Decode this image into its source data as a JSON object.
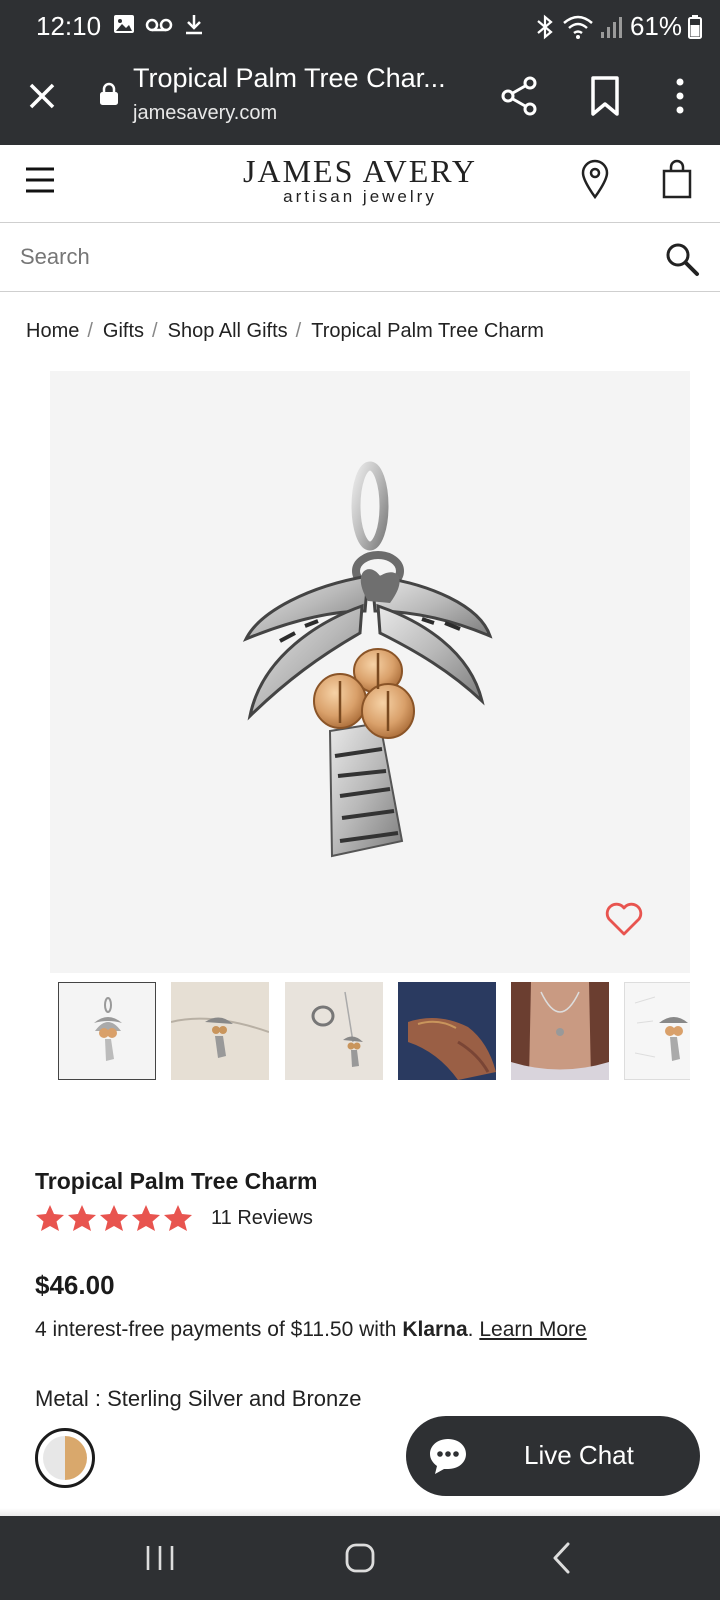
{
  "status_bar": {
    "time": "12:10",
    "battery": "61%",
    "icons": [
      "image-icon",
      "voicemail-icon",
      "download-icon",
      "bluetooth-icon",
      "wifi-icon",
      "signal-icon",
      "battery-icon"
    ]
  },
  "browser": {
    "title": "Tropical Palm Tree Char...",
    "domain": "jamesavery.com",
    "icons": [
      "close-icon",
      "lock-icon",
      "share-icon",
      "bookmark-icon",
      "more-vertical-icon"
    ]
  },
  "site_header": {
    "brand_name": "JAMES AVERY",
    "brand_tagline": "artisan jewelry",
    "icons": [
      "menu-icon",
      "location-pin-icon",
      "shopping-bag-icon"
    ]
  },
  "search": {
    "placeholder": "Search"
  },
  "breadcrumb": {
    "items": [
      "Home",
      "Gifts",
      "Shop All Gifts",
      "Tropical Palm Tree Charm"
    ],
    "separator": "/"
  },
  "gallery": {
    "thumbnail_count": 6,
    "selected_index": 0
  },
  "product": {
    "name": "Tropical Palm Tree Charm",
    "rating": 5,
    "reviews_label": "11 Reviews",
    "price": "$46.00",
    "financing_prefix": "4 interest-free payments of $11.50 with ",
    "financing_brand": "Klarna",
    "financing_suffix": ". ",
    "learn_more": "Learn More",
    "metal_label": "Metal : Sterling Silver and Bronze"
  },
  "chat": {
    "label": "Live Chat"
  },
  "colors": {
    "dark_bar": "#2e3033",
    "star": "#e8544f",
    "heart": "#e8544f",
    "image_bg": "#f4f4f4"
  }
}
